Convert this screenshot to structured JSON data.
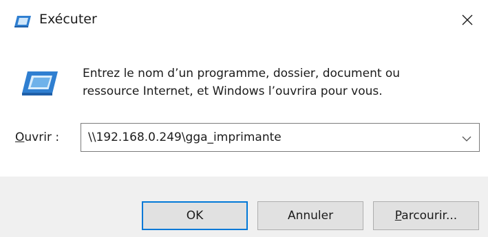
{
  "window": {
    "title": "Exécuter",
    "title_icon": "run-icon",
    "close_icon": "close-icon"
  },
  "content": {
    "icon": "run-icon",
    "description_line1": "Entrez le nom d’un programme, dossier, document ou",
    "description_line2": "ressource Internet, et Windows l’ouvrira pour vous.",
    "open_label_mnemonic": "O",
    "open_label_rest": "uvrir :",
    "open_value": "\\\\192.168.0.249\\gga_imprimante",
    "dropdown_icon": "chevron-down-icon"
  },
  "buttons": {
    "ok_label": "OK",
    "cancel_label": "Annuler",
    "browse_mnemonic": "P",
    "browse_rest": "arcourir..."
  },
  "colors": {
    "accent": "#0078d7",
    "footer_bg": "#f0f0f0",
    "button_bg": "#e1e1e1",
    "text": "#1b1b1b"
  }
}
